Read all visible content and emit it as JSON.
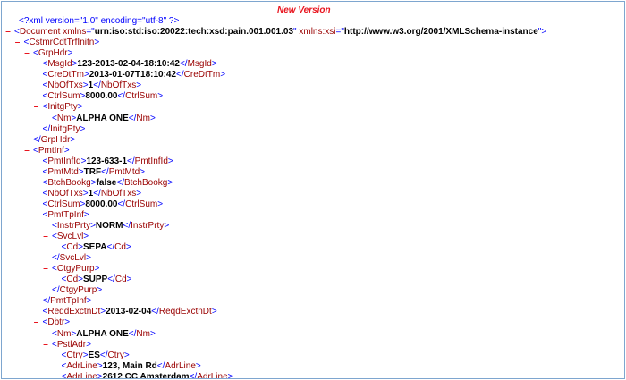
{
  "caption": "New Version",
  "toggle_symbol": "–",
  "colors": {
    "markup": "#0000ff",
    "tag_name": "#990000",
    "text_value": "#000000",
    "toggle": "#e8141e",
    "caption": "#e8141e",
    "frame_border": "#7ea6cf"
  },
  "lines": [
    {
      "pi": "xml version=\"1.0\" encoding=\"utf-8\" ?"
    },
    {
      "toggle": true,
      "open": "Document",
      "attrs": [
        {
          "name": "xmlns",
          "value": "urn:iso:std:iso:20022:tech:xsd:pain.001.001.03"
        },
        {
          "name": "xmlns:xsi",
          "value": "http://www.w3.org/2001/XMLSchema-instance"
        }
      ]
    },
    {
      "toggle": true,
      "open": "CstmrCdtTrfInitn"
    },
    {
      "toggle": true,
      "open": "GrpHdr"
    },
    {
      "open": "MsgId",
      "text": "123-2013-02-04-18:10:42",
      "close": "MsgId"
    },
    {
      "open": "CreDtTm",
      "text": "2013-01-07T18:10:42",
      "close": "CreDtTm"
    },
    {
      "open": "NbOfTxs",
      "text": "1",
      "close": "NbOfTxs"
    },
    {
      "open": "CtrlSum",
      "text": "8000.00",
      "close": "CtrlSum"
    },
    {
      "toggle": true,
      "open": "InitgPty"
    },
    {
      "open": "Nm",
      "text": "ALPHA ONE",
      "close": "Nm"
    },
    {
      "close": "InitgPty"
    },
    {
      "close": "GrpHdr"
    },
    {
      "toggle": true,
      "open": "PmtInf"
    },
    {
      "open": "PmtInfId",
      "text": "123-633-1",
      "close": "PmtInfId"
    },
    {
      "open": "PmtMtd",
      "text": "TRF",
      "close": "PmtMtd"
    },
    {
      "open": "BtchBookg",
      "text": "false",
      "close": "BtchBookg"
    },
    {
      "open": "NbOfTxs",
      "text": "1",
      "close": "NbOfTxs"
    },
    {
      "open": "CtrlSum",
      "text": "8000.00",
      "close": "CtrlSum"
    },
    {
      "toggle": true,
      "open": "PmtTpInf"
    },
    {
      "open": "InstrPrty",
      "text": "NORM",
      "close": "InstrPrty"
    },
    {
      "toggle": true,
      "open": "SvcLvl"
    },
    {
      "open": "Cd",
      "text": "SEPA",
      "close": "Cd"
    },
    {
      "close": "SvcLvl"
    },
    {
      "toggle": true,
      "open": "CtgyPurp"
    },
    {
      "open": "Cd",
      "text": "SUPP",
      "close": "Cd"
    },
    {
      "close": "CtgyPurp"
    },
    {
      "close": "PmtTpInf"
    },
    {
      "open": "ReqdExctnDt",
      "text": "2013-02-04",
      "close": "ReqdExctnDt"
    },
    {
      "toggle": true,
      "open": "Dbtr"
    },
    {
      "open": "Nm",
      "text": "ALPHA ONE",
      "close": "Nm"
    },
    {
      "toggle": true,
      "open": "PstlAdr"
    },
    {
      "open": "Ctry",
      "text": "ES",
      "close": "Ctry"
    },
    {
      "open": "AdrLine",
      "text": "123, Main Rd",
      "close": "AdrLine"
    },
    {
      "open": "AdrLine",
      "text": "2612 CC Amsterdam",
      "close": "AdrLine"
    }
  ]
}
